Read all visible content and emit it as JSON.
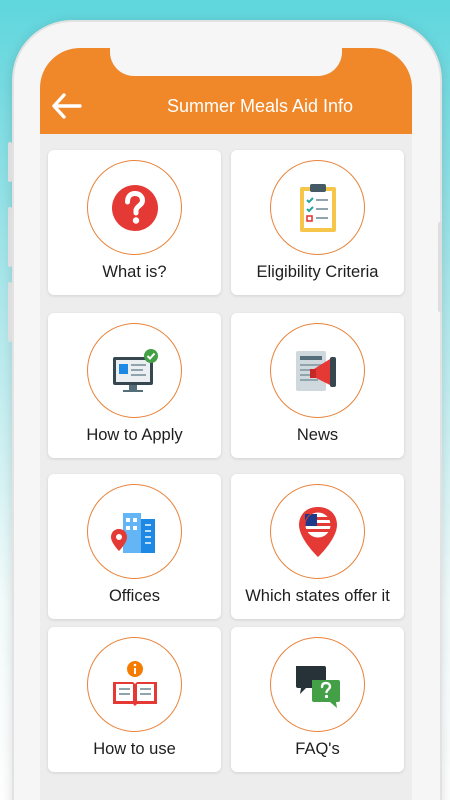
{
  "app_title": "Summer Meals Aid Info",
  "accent_color": "#f0882a",
  "back_icon": "arrow-left-icon",
  "menu": [
    {
      "label": "What is?",
      "icon": "question-icon"
    },
    {
      "label": "Eligibility Criteria",
      "icon": "checklist-clipboard-icon"
    },
    {
      "label": "How to Apply",
      "icon": "monitor-form-icon"
    },
    {
      "label": "News",
      "icon": "newspaper-megaphone-icon"
    },
    {
      "label": "Offices",
      "icon": "office-building-pin-icon"
    },
    {
      "label": "Which states offer it",
      "icon": "us-flag-pin-icon"
    },
    {
      "label": "How to use",
      "icon": "book-info-icon"
    },
    {
      "label": "FAQ's",
      "icon": "chat-question-icon"
    }
  ]
}
